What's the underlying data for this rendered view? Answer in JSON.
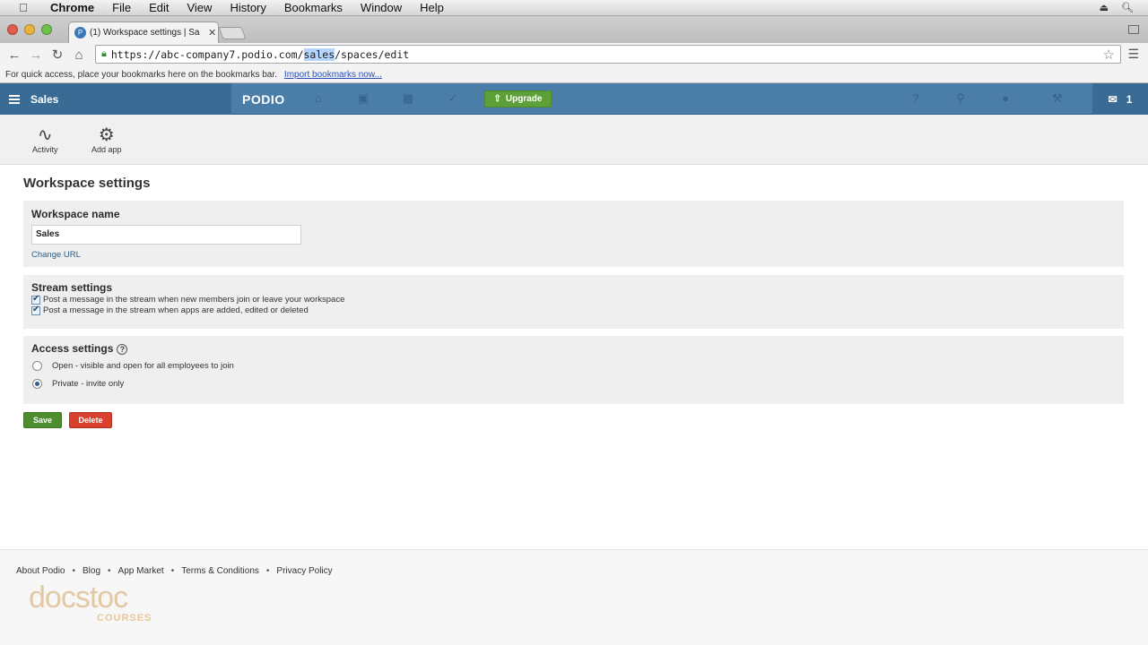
{
  "mac_menu": {
    "app": "Chrome",
    "items": [
      "File",
      "Edit",
      "View",
      "History",
      "Bookmarks",
      "Window",
      "Help"
    ]
  },
  "browser": {
    "tab_title": "(1) Workspace settings | Sa",
    "url_prefix": "https://abc-company7.podio.com/",
    "url_selected": "sales",
    "url_suffix": "/spaces/edit",
    "bookmarks_hint": "For quick access, place your bookmarks here on the bookmarks bar.",
    "import_link": "Import bookmarks now..."
  },
  "podio": {
    "space_name": "Sales",
    "logo": "PODIO",
    "upgrade_label": "Upgrade",
    "notification_count": "1",
    "icons": [
      "home-icon",
      "stream-icon",
      "calendar-icon",
      "tasks-icon",
      "help-icon",
      "search-icon",
      "contacts-icon",
      "tools-icon"
    ]
  },
  "appbar": {
    "activity": "Activity",
    "add_app": "Add app"
  },
  "main": {
    "title": "Workspace settings",
    "workspace_name_heading": "Workspace name",
    "workspace_name_value": "Sales",
    "change_url": "Change URL",
    "stream_heading": "Stream settings",
    "stream_options": [
      "Post a message in the stream when new members join or leave your workspace",
      "Post a message in the stream when apps are added, edited or deleted"
    ],
    "access_heading": "Access settings",
    "access_options": [
      "Open - visible and open for all employees to join",
      "Private - invite only"
    ],
    "access_selected": "Private - invite only",
    "save": "Save",
    "delete": "Delete"
  },
  "footer": {
    "links": [
      "About Podio",
      "Blog",
      "App Market",
      "Terms & Conditions",
      "Privacy Policy"
    ],
    "watermark": "docstoc",
    "watermark_sub": "COURSES"
  },
  "colors": {
    "podio_header": "#4a7ea8",
    "save_button": "#4e8d2f",
    "delete_button": "#d9402e",
    "upgrade_button": "#5da037"
  }
}
